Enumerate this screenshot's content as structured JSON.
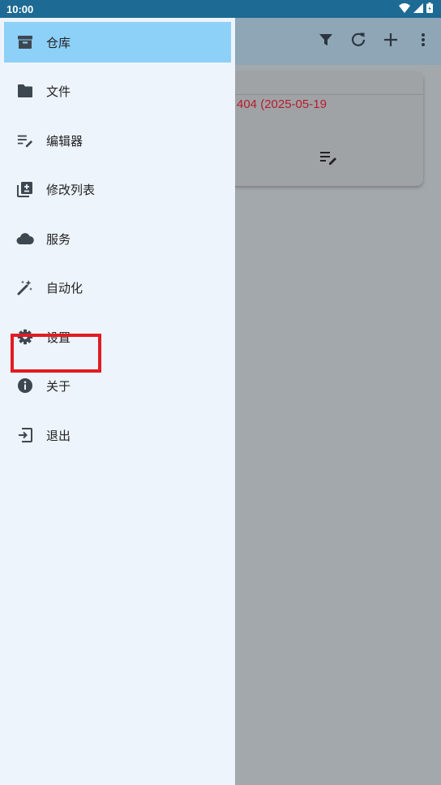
{
  "status_bar": {
    "time": "10:00"
  },
  "toolbar": {
    "actions": [
      {
        "icon": "filter-icon"
      },
      {
        "icon": "refresh-icon"
      },
      {
        "icon": "add-icon"
      },
      {
        "icon": "more-vert-icon"
      }
    ]
  },
  "card": {
    "version_text": "404 (2025-05-19"
  },
  "drawer": {
    "items": [
      {
        "label": "仓库",
        "icon": "archive-icon",
        "active": true
      },
      {
        "label": "文件",
        "icon": "folder-icon"
      },
      {
        "label": "编辑器",
        "icon": "edit-note-icon"
      },
      {
        "label": "修改列表",
        "icon": "changelist-icon"
      },
      {
        "label": "服务",
        "icon": "cloud-icon"
      },
      {
        "label": "自动化",
        "icon": "magic-wand-icon"
      },
      {
        "label": "设置",
        "icon": "gear-icon",
        "highlighted": true
      },
      {
        "label": "关于",
        "icon": "info-icon"
      },
      {
        "label": "退出",
        "icon": "exit-icon"
      }
    ]
  },
  "colors": {
    "accent": "#8dd0f8",
    "status_bar": "#1d6a94",
    "highlight": "#e31b23",
    "version_text": "#b71c2b"
  }
}
